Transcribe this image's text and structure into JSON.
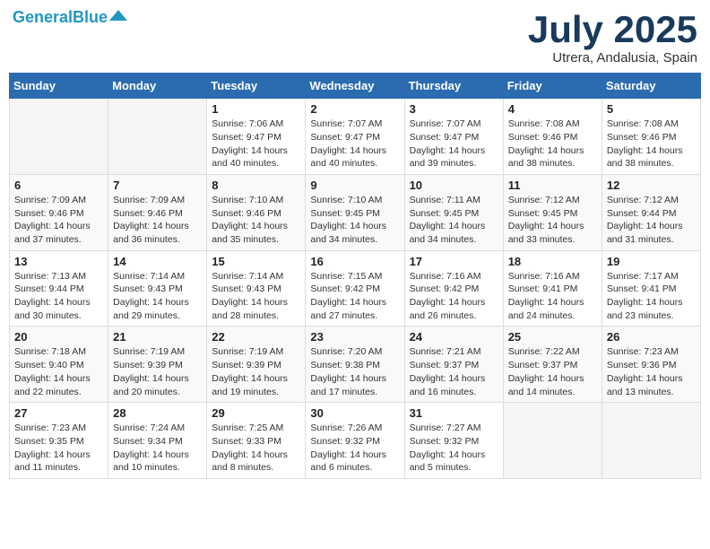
{
  "header": {
    "logo_general": "General",
    "logo_blue": "Blue",
    "month_title": "July 2025",
    "location": "Utrera, Andalusia, Spain"
  },
  "weekdays": [
    "Sunday",
    "Monday",
    "Tuesday",
    "Wednesday",
    "Thursday",
    "Friday",
    "Saturday"
  ],
  "weeks": [
    [
      {
        "day": "",
        "sunrise": "",
        "sunset": "",
        "daylight": ""
      },
      {
        "day": "",
        "sunrise": "",
        "sunset": "",
        "daylight": ""
      },
      {
        "day": "1",
        "sunrise": "Sunrise: 7:06 AM",
        "sunset": "Sunset: 9:47 PM",
        "daylight": "Daylight: 14 hours and 40 minutes."
      },
      {
        "day": "2",
        "sunrise": "Sunrise: 7:07 AM",
        "sunset": "Sunset: 9:47 PM",
        "daylight": "Daylight: 14 hours and 40 minutes."
      },
      {
        "day": "3",
        "sunrise": "Sunrise: 7:07 AM",
        "sunset": "Sunset: 9:47 PM",
        "daylight": "Daylight: 14 hours and 39 minutes."
      },
      {
        "day": "4",
        "sunrise": "Sunrise: 7:08 AM",
        "sunset": "Sunset: 9:46 PM",
        "daylight": "Daylight: 14 hours and 38 minutes."
      },
      {
        "day": "5",
        "sunrise": "Sunrise: 7:08 AM",
        "sunset": "Sunset: 9:46 PM",
        "daylight": "Daylight: 14 hours and 38 minutes."
      }
    ],
    [
      {
        "day": "6",
        "sunrise": "Sunrise: 7:09 AM",
        "sunset": "Sunset: 9:46 PM",
        "daylight": "Daylight: 14 hours and 37 minutes."
      },
      {
        "day": "7",
        "sunrise": "Sunrise: 7:09 AM",
        "sunset": "Sunset: 9:46 PM",
        "daylight": "Daylight: 14 hours and 36 minutes."
      },
      {
        "day": "8",
        "sunrise": "Sunrise: 7:10 AM",
        "sunset": "Sunset: 9:46 PM",
        "daylight": "Daylight: 14 hours and 35 minutes."
      },
      {
        "day": "9",
        "sunrise": "Sunrise: 7:10 AM",
        "sunset": "Sunset: 9:45 PM",
        "daylight": "Daylight: 14 hours and 34 minutes."
      },
      {
        "day": "10",
        "sunrise": "Sunrise: 7:11 AM",
        "sunset": "Sunset: 9:45 PM",
        "daylight": "Daylight: 14 hours and 34 minutes."
      },
      {
        "day": "11",
        "sunrise": "Sunrise: 7:12 AM",
        "sunset": "Sunset: 9:45 PM",
        "daylight": "Daylight: 14 hours and 33 minutes."
      },
      {
        "day": "12",
        "sunrise": "Sunrise: 7:12 AM",
        "sunset": "Sunset: 9:44 PM",
        "daylight": "Daylight: 14 hours and 31 minutes."
      }
    ],
    [
      {
        "day": "13",
        "sunrise": "Sunrise: 7:13 AM",
        "sunset": "Sunset: 9:44 PM",
        "daylight": "Daylight: 14 hours and 30 minutes."
      },
      {
        "day": "14",
        "sunrise": "Sunrise: 7:14 AM",
        "sunset": "Sunset: 9:43 PM",
        "daylight": "Daylight: 14 hours and 29 minutes."
      },
      {
        "day": "15",
        "sunrise": "Sunrise: 7:14 AM",
        "sunset": "Sunset: 9:43 PM",
        "daylight": "Daylight: 14 hours and 28 minutes."
      },
      {
        "day": "16",
        "sunrise": "Sunrise: 7:15 AM",
        "sunset": "Sunset: 9:42 PM",
        "daylight": "Daylight: 14 hours and 27 minutes."
      },
      {
        "day": "17",
        "sunrise": "Sunrise: 7:16 AM",
        "sunset": "Sunset: 9:42 PM",
        "daylight": "Daylight: 14 hours and 26 minutes."
      },
      {
        "day": "18",
        "sunrise": "Sunrise: 7:16 AM",
        "sunset": "Sunset: 9:41 PM",
        "daylight": "Daylight: 14 hours and 24 minutes."
      },
      {
        "day": "19",
        "sunrise": "Sunrise: 7:17 AM",
        "sunset": "Sunset: 9:41 PM",
        "daylight": "Daylight: 14 hours and 23 minutes."
      }
    ],
    [
      {
        "day": "20",
        "sunrise": "Sunrise: 7:18 AM",
        "sunset": "Sunset: 9:40 PM",
        "daylight": "Daylight: 14 hours and 22 minutes."
      },
      {
        "day": "21",
        "sunrise": "Sunrise: 7:19 AM",
        "sunset": "Sunset: 9:39 PM",
        "daylight": "Daylight: 14 hours and 20 minutes."
      },
      {
        "day": "22",
        "sunrise": "Sunrise: 7:19 AM",
        "sunset": "Sunset: 9:39 PM",
        "daylight": "Daylight: 14 hours and 19 minutes."
      },
      {
        "day": "23",
        "sunrise": "Sunrise: 7:20 AM",
        "sunset": "Sunset: 9:38 PM",
        "daylight": "Daylight: 14 hours and 17 minutes."
      },
      {
        "day": "24",
        "sunrise": "Sunrise: 7:21 AM",
        "sunset": "Sunset: 9:37 PM",
        "daylight": "Daylight: 14 hours and 16 minutes."
      },
      {
        "day": "25",
        "sunrise": "Sunrise: 7:22 AM",
        "sunset": "Sunset: 9:37 PM",
        "daylight": "Daylight: 14 hours and 14 minutes."
      },
      {
        "day": "26",
        "sunrise": "Sunrise: 7:23 AM",
        "sunset": "Sunset: 9:36 PM",
        "daylight": "Daylight: 14 hours and 13 minutes."
      }
    ],
    [
      {
        "day": "27",
        "sunrise": "Sunrise: 7:23 AM",
        "sunset": "Sunset: 9:35 PM",
        "daylight": "Daylight: 14 hours and 11 minutes."
      },
      {
        "day": "28",
        "sunrise": "Sunrise: 7:24 AM",
        "sunset": "Sunset: 9:34 PM",
        "daylight": "Daylight: 14 hours and 10 minutes."
      },
      {
        "day": "29",
        "sunrise": "Sunrise: 7:25 AM",
        "sunset": "Sunset: 9:33 PM",
        "daylight": "Daylight: 14 hours and 8 minutes."
      },
      {
        "day": "30",
        "sunrise": "Sunrise: 7:26 AM",
        "sunset": "Sunset: 9:32 PM",
        "daylight": "Daylight: 14 hours and 6 minutes."
      },
      {
        "day": "31",
        "sunrise": "Sunrise: 7:27 AM",
        "sunset": "Sunset: 9:32 PM",
        "daylight": "Daylight: 14 hours and 5 minutes."
      },
      {
        "day": "",
        "sunrise": "",
        "sunset": "",
        "daylight": ""
      },
      {
        "day": "",
        "sunrise": "",
        "sunset": "",
        "daylight": ""
      }
    ]
  ]
}
